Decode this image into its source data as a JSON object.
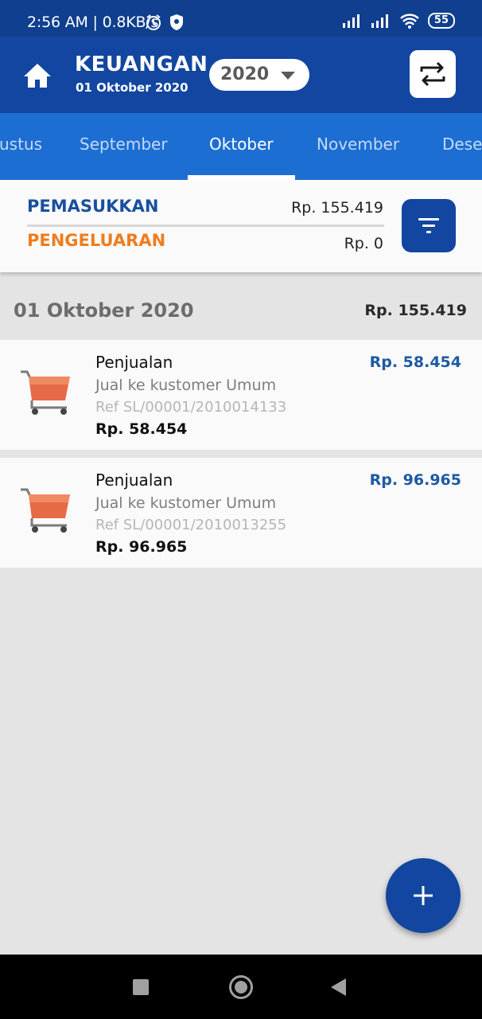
{
  "status_bar": {
    "time": "2:56 AM",
    "speed": "0.8KB/s",
    "battery": "55",
    "icons": [
      "alarm-icon",
      "shield-icon",
      "signal-icon",
      "signal-icon",
      "wifi-icon",
      "battery-icon"
    ]
  },
  "header": {
    "title": "KEUANGAN",
    "date": "01 Oktober 2020",
    "year": "2020",
    "icons": [
      "home-icon",
      "chevron-down-icon",
      "swap-icon"
    ],
    "colors": {
      "appbar": "#1246a0",
      "tabs": "#1d6ed3"
    }
  },
  "tabs": [
    {
      "label": "ustus",
      "active": false
    },
    {
      "label": "September",
      "active": false
    },
    {
      "label": "Oktober",
      "active": true
    },
    {
      "label": "November",
      "active": false
    },
    {
      "label": "Dese",
      "active": false
    }
  ],
  "summary": {
    "income_label": "PEMASUKKAN",
    "income_value": "Rp. 155.419",
    "expense_label": "PENGELUARAN",
    "expense_value": "Rp. 0",
    "filter_icon": "filter-icon",
    "colors": {
      "income": "#1a4fa0",
      "expense": "#ee7d1f"
    }
  },
  "group": {
    "date": "01 Oktober 2020",
    "total": "Rp. 155.419"
  },
  "transactions": [
    {
      "title": "Penjualan",
      "subtitle": "Jual ke kustomer Umum",
      "ref": "Ref SL/00001/2010014133",
      "amount": "Rp. 58.454",
      "amount_right": "Rp. 58.454",
      "icon": "shopping-cart-icon"
    },
    {
      "title": "Penjualan",
      "subtitle": "Jual ke kustomer Umum",
      "ref": "Ref SL/00001/2010013255",
      "amount": "Rp. 96.965",
      "amount_right": "Rp. 96.965",
      "icon": "shopping-cart-icon"
    }
  ],
  "fab": {
    "icon": "plus-icon"
  },
  "nav": {
    "icons": [
      "recents-icon",
      "home-circle-icon",
      "back-icon"
    ]
  }
}
